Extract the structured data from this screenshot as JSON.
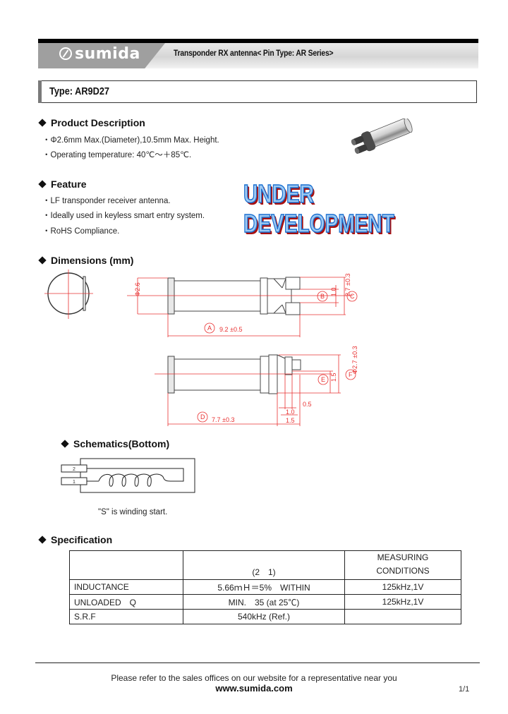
{
  "header": {
    "brand": "sumida",
    "title": "Transponder RX antenna< Pin Type: AR Series>"
  },
  "type_label": "Type: AR9D27",
  "product_description": {
    "heading": "Product Description",
    "items": [
      "Φ2.6mm Max.(Diameter),10.5mm Max. Height.",
      "Operating temperature:    40℃～＋85℃."
    ]
  },
  "feature": {
    "heading": "Feature",
    "items": [
      "LF transponder receiver antenna.",
      "Ideally used in keyless smart entry system.",
      "RoHS Compliance."
    ]
  },
  "watermark": "UNDER DEVELOPMENT",
  "dimensions": {
    "heading": "Dimensions (mm)",
    "labels": {
      "diameter": "Φ2.6",
      "A": "A",
      "A_value": "9.2 ±0.5",
      "B": "B",
      "B_value": "1.0",
      "C": "C",
      "C_value": "2.7 ±0.3",
      "D": "D",
      "D_value": "7.7 ±0.3",
      "E": "E",
      "E_value": "1.5",
      "F": "F",
      "F_value": "Φ2.7 ±0.3",
      "pin_0_5": "0.5",
      "pin_1_0": "1.0",
      "pin_1_5": "1.5"
    },
    "line_color": "#e83030"
  },
  "schematics": {
    "heading": "Schematics(Bottom)",
    "pin_top": "2",
    "pin_bottom": "1",
    "note": "\"S\" is winding start."
  },
  "specification": {
    "heading": "Specification",
    "header": [
      "",
      "(2　1)",
      "MEASURING CONDITIONS"
    ],
    "header_cond_lines": [
      "MEASURING",
      "CONDITIONS"
    ],
    "rows": [
      [
        "INDUCTANCE",
        "5.66ｍＨ＝5%　WITHIN",
        "125kHz,1V"
      ],
      [
        "UNLOADED　Q",
        "MIN.　35 (at 25℃)",
        "125kHz,1V"
      ],
      [
        "S.R.F",
        "540kHz (Ref.)",
        ""
      ]
    ]
  },
  "footer": {
    "note": "Please refer to the sales offices on our website for a representative near you",
    "url": "www.sumida.com",
    "page": "1/1"
  }
}
